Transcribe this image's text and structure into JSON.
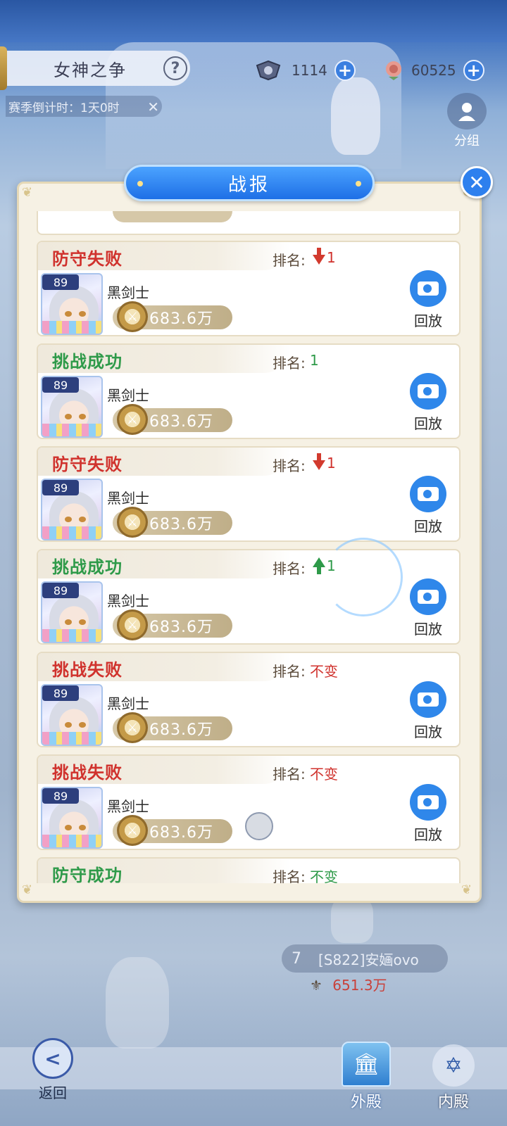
{
  "header": {
    "title": "女神之争",
    "help": "?",
    "season_text": "赛季倒计时：1天0时",
    "currency": [
      {
        "icon": "emblem-icon",
        "value": "1114"
      },
      {
        "icon": "rose-icon",
        "value": "60525"
      }
    ],
    "group_label": "分组"
  },
  "dialog": {
    "title": "战报",
    "close": "✕",
    "rank_label": "排名:",
    "replay_label": "回放",
    "entries": [
      {
        "result": "防守失败",
        "color": "red",
        "rank_change": "down",
        "rank": "1",
        "level": "89",
        "name": "黑剑士",
        "power": "683.6万"
      },
      {
        "result": "挑战成功",
        "color": "green",
        "rank_change": "none",
        "rank": "1",
        "level": "89",
        "name": "黑剑士",
        "power": "683.6万"
      },
      {
        "result": "防守失败",
        "color": "red",
        "rank_change": "down",
        "rank": "1",
        "level": "89",
        "name": "黑剑士",
        "power": "683.6万"
      },
      {
        "result": "挑战成功",
        "color": "green",
        "rank_change": "up",
        "rank": "1",
        "level": "89",
        "name": "黑剑士",
        "power": "683.6万"
      },
      {
        "result": "挑战失败",
        "color": "red",
        "rank_change": "none",
        "rank": "不变",
        "level": "89",
        "name": "黑剑士",
        "power": "683.6万"
      },
      {
        "result": "挑战失败",
        "color": "red",
        "rank_change": "none",
        "rank": "不变",
        "level": "89",
        "name": "黑剑士",
        "power": "683.6万"
      },
      {
        "result": "防守成功",
        "color": "green",
        "rank_change": "none",
        "rank": "不变",
        "level": "",
        "name": "",
        "power": ""
      }
    ]
  },
  "scene": {
    "opponent_rank": "7",
    "opponent_name": "[S822]安婳ovo",
    "opponent_power": "651.3万"
  },
  "bottom": {
    "back": "返回",
    "outer": "外殿",
    "inner": "内殿"
  },
  "colors": {
    "red": "#d0322d",
    "green": "#2e9a49",
    "blue": "#2f87ea"
  }
}
